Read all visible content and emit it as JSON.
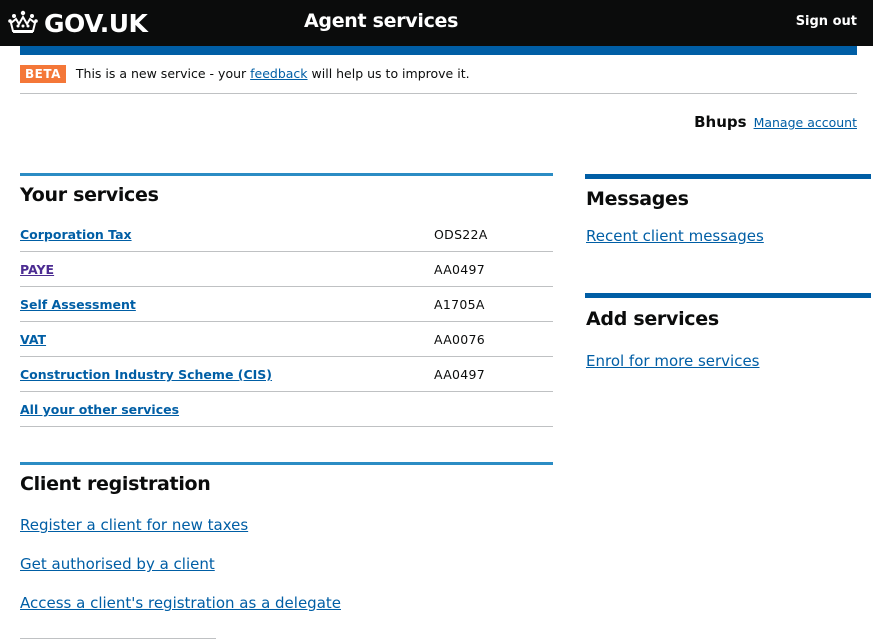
{
  "header": {
    "logo_text": "GOV.UK",
    "service_name": "Agent services",
    "sign_out": "Sign out"
  },
  "beta": {
    "tag": "BETA",
    "text_before": "This is a new service - your ",
    "feedback_link": "feedback",
    "text_after": " will help us to improve it."
  },
  "account": {
    "name": "Bhups",
    "manage_link": "Manage account"
  },
  "your_services": {
    "title": "Your services",
    "rows": [
      {
        "label": "Corporation Tax",
        "code": "ODS22A"
      },
      {
        "label": "PAYE",
        "code": "AA0497"
      },
      {
        "label": "Self Assessment",
        "code": "A1705A"
      },
      {
        "label": "VAT",
        "code": "AA0076"
      },
      {
        "label": "Construction Industry Scheme (CIS)",
        "code": "AA0497"
      },
      {
        "label": "All your other services",
        "code": ""
      }
    ]
  },
  "client_registration": {
    "title": "Client registration",
    "links": [
      "Register a client for new taxes",
      "Get authorised by a client",
      "Access a client's registration as a delegate"
    ]
  },
  "messages": {
    "title": "Messages",
    "link": "Recent client messages"
  },
  "add_services": {
    "title": "Add services",
    "link": "Enrol for more services"
  },
  "colors": {
    "header_bg": "#0b0c0c",
    "brand_blue": "#005ea5",
    "beta_orange": "#f47738",
    "visited_link": "#4c2c92"
  }
}
